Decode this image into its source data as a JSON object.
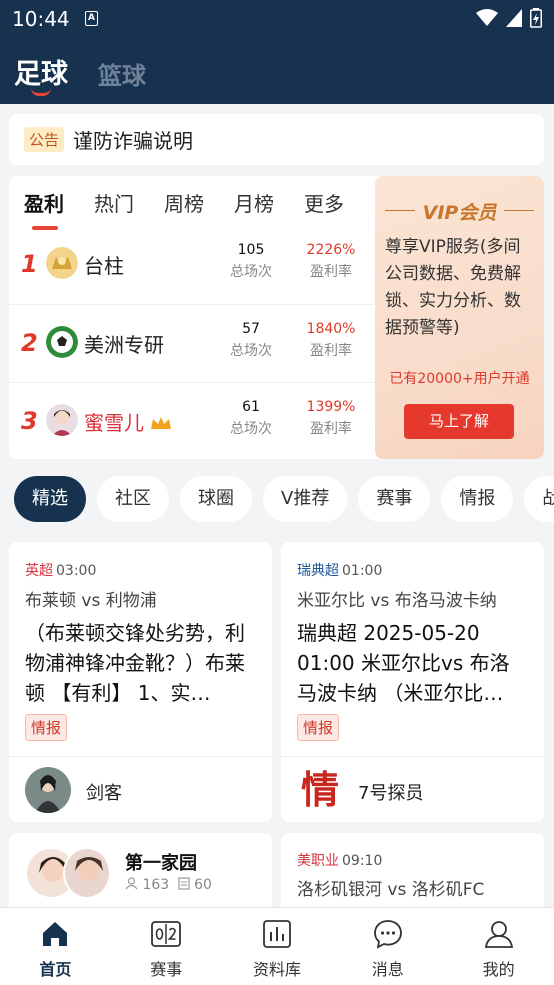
{
  "status_bar": {
    "time": "10:44",
    "a_icon": "A"
  },
  "top_tabs": [
    {
      "label": "足球"
    },
    {
      "label": "篮球"
    }
  ],
  "notice": {
    "badge": "公告",
    "text": "谨防诈骗说明"
  },
  "ranking": {
    "tabs": [
      {
        "label": "盈利"
      },
      {
        "label": "热门"
      },
      {
        "label": "周榜"
      },
      {
        "label": "月榜"
      },
      {
        "label": "更多"
      }
    ],
    "rows": [
      {
        "rank": "1",
        "name": "台柱",
        "count": "105",
        "count_label": "总场次",
        "rate": "2226%",
        "rate_label": "盈利率"
      },
      {
        "rank": "2",
        "name": "美洲专研",
        "count": "57",
        "count_label": "总场次",
        "rate": "1840%",
        "rate_label": "盈利率"
      },
      {
        "rank": "3",
        "name": "蜜雪儿",
        "count": "61",
        "count_label": "总场次",
        "rate": "1399%",
        "rate_label": "盈利率"
      }
    ],
    "vip": {
      "title": "VIP会员",
      "desc": "尊享VIP服务(多间公司数据、免费解锁、实力分析、数据预警等)",
      "users": "已有20000+用户开通",
      "button": "马上了解"
    }
  },
  "chips": [
    {
      "label": "精选"
    },
    {
      "label": "社区"
    },
    {
      "label": "球圈"
    },
    {
      "label": "V推荐"
    },
    {
      "label": "赛事"
    },
    {
      "label": "情报"
    },
    {
      "label": "战"
    }
  ],
  "feed": [
    {
      "league": "英超",
      "time": "03:00",
      "match": "布莱顿 vs 利物浦",
      "body": "（布莱顿交锋处劣势，利物浦神锋冲金靴？）布莱顿 【有利】 1、实…",
      "tag": "情报",
      "author": "剑客"
    },
    {
      "league": "瑞典超",
      "time": "01:00",
      "match": "米亚尔比 vs 布洛马波卡纳",
      "body": "瑞典超 2025-05-20 01:00 米亚尔比vs 布洛马波卡纳 （米亚尔比…",
      "tag": "情报",
      "author": "7号探员",
      "author_glyph": "情"
    }
  ],
  "community": {
    "name": "第一家园",
    "members": "163",
    "posts": "60"
  },
  "feed_peek": {
    "league": "美职业",
    "time": "09:10",
    "match": "洛杉矶银河 vs 洛杉矶FC"
  },
  "bottom_nav": [
    {
      "label": "首页",
      "icon": "home-icon"
    },
    {
      "label": "赛事",
      "icon": "scoreboard-icon",
      "icon_text": "0|2"
    },
    {
      "label": "资料库",
      "icon": "bar-chart-icon"
    },
    {
      "label": "消息",
      "icon": "chat-bubble-icon"
    },
    {
      "label": "我的",
      "icon": "user-icon"
    }
  ],
  "colors": {
    "header": "#16324f",
    "accent_red": "#e0392b",
    "vip_button": "#e5392d"
  }
}
